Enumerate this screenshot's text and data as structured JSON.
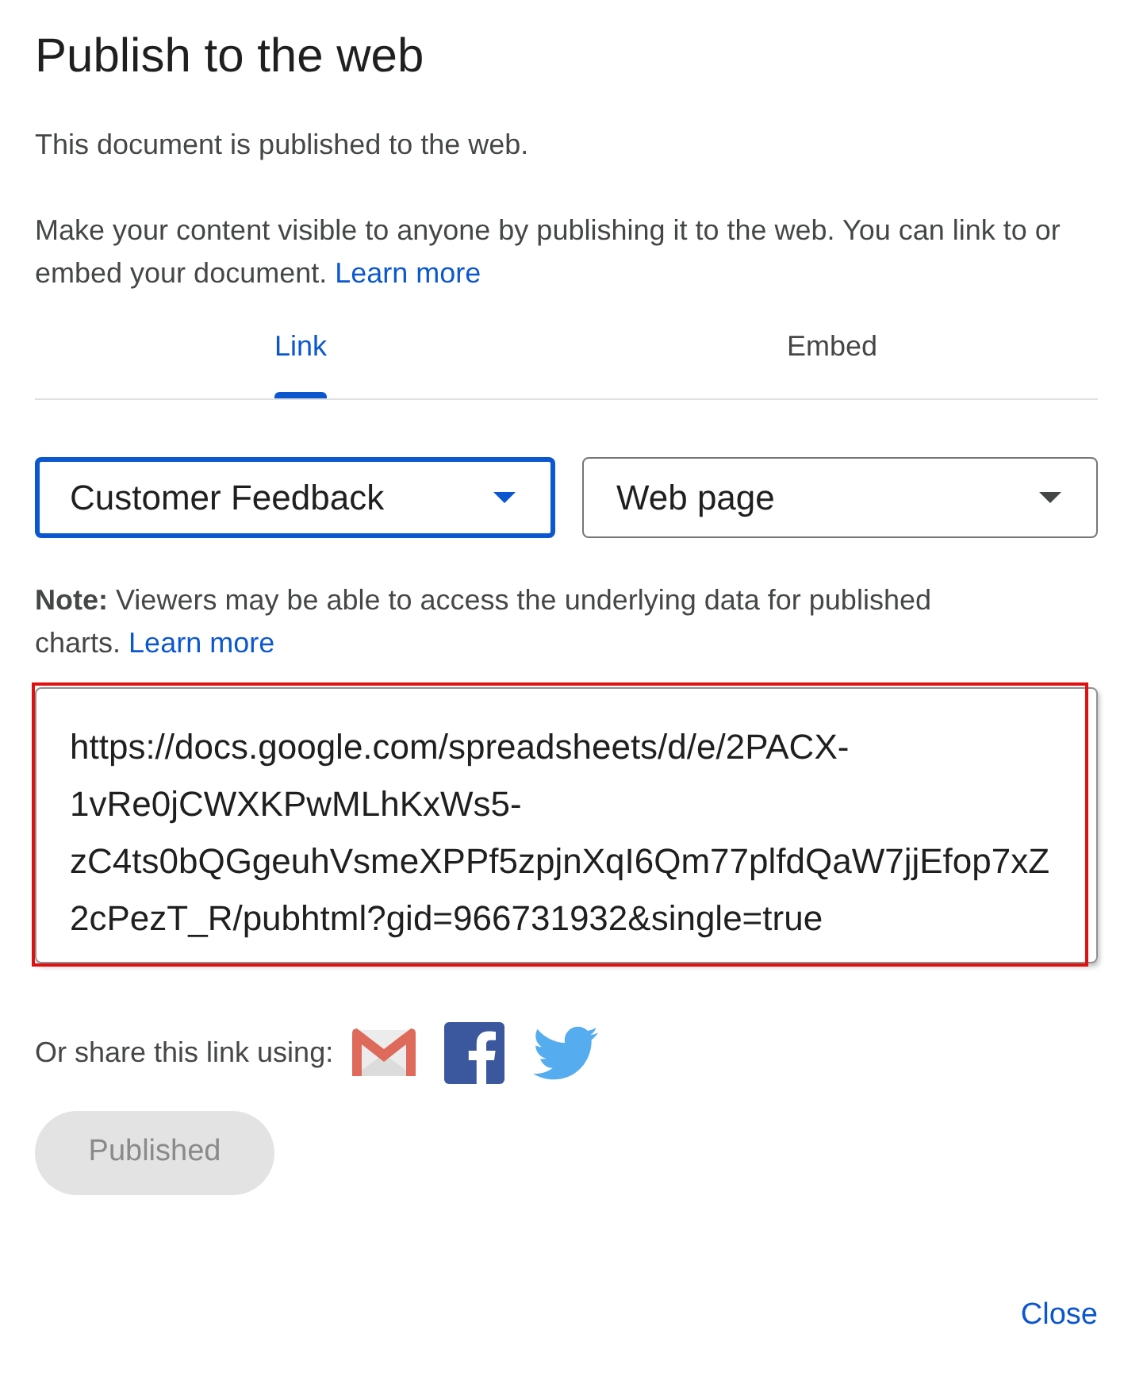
{
  "dialog": {
    "title": "Publish to the web",
    "status": "This document is published to the web.",
    "intro": {
      "text": "Make your content visible to anyone by publishing it to the web. You can link to or embed your document.",
      "link": "Learn more"
    }
  },
  "tabs": [
    {
      "label": "Link",
      "selected": true
    },
    {
      "label": "Embed",
      "selected": false
    }
  ],
  "dropdowns": [
    {
      "value": "Customer Feedback",
      "focused": true
    },
    {
      "value": "Web page",
      "focused": false
    }
  ],
  "note": {
    "text": "**Note:** Viewers may be able to access the underlying data for published charts.",
    "link": "Learn more"
  },
  "link_box": {
    "value": "https://docs.google.com/spreadsheets/d/e/2PACX-1vRe0jCWXKPwMLhKxWs5-zC4ts0bQGgeuhVsmeXPPf5zpjnXqI6Qm77plfdQaW7jjEfop7xZ2cPezT_R/pubhtml?gid=966731932&single=true",
    "highlighted": true
  },
  "share": {
    "label": "Or share this link using:",
    "services": [
      {
        "kind": "gmail"
      },
      {
        "kind": "facebook"
      },
      {
        "kind": "twitter"
      }
    ]
  },
  "publish_button": {
    "label": "Published",
    "disabled": true
  },
  "close_button": {
    "label": "Close"
  }
}
